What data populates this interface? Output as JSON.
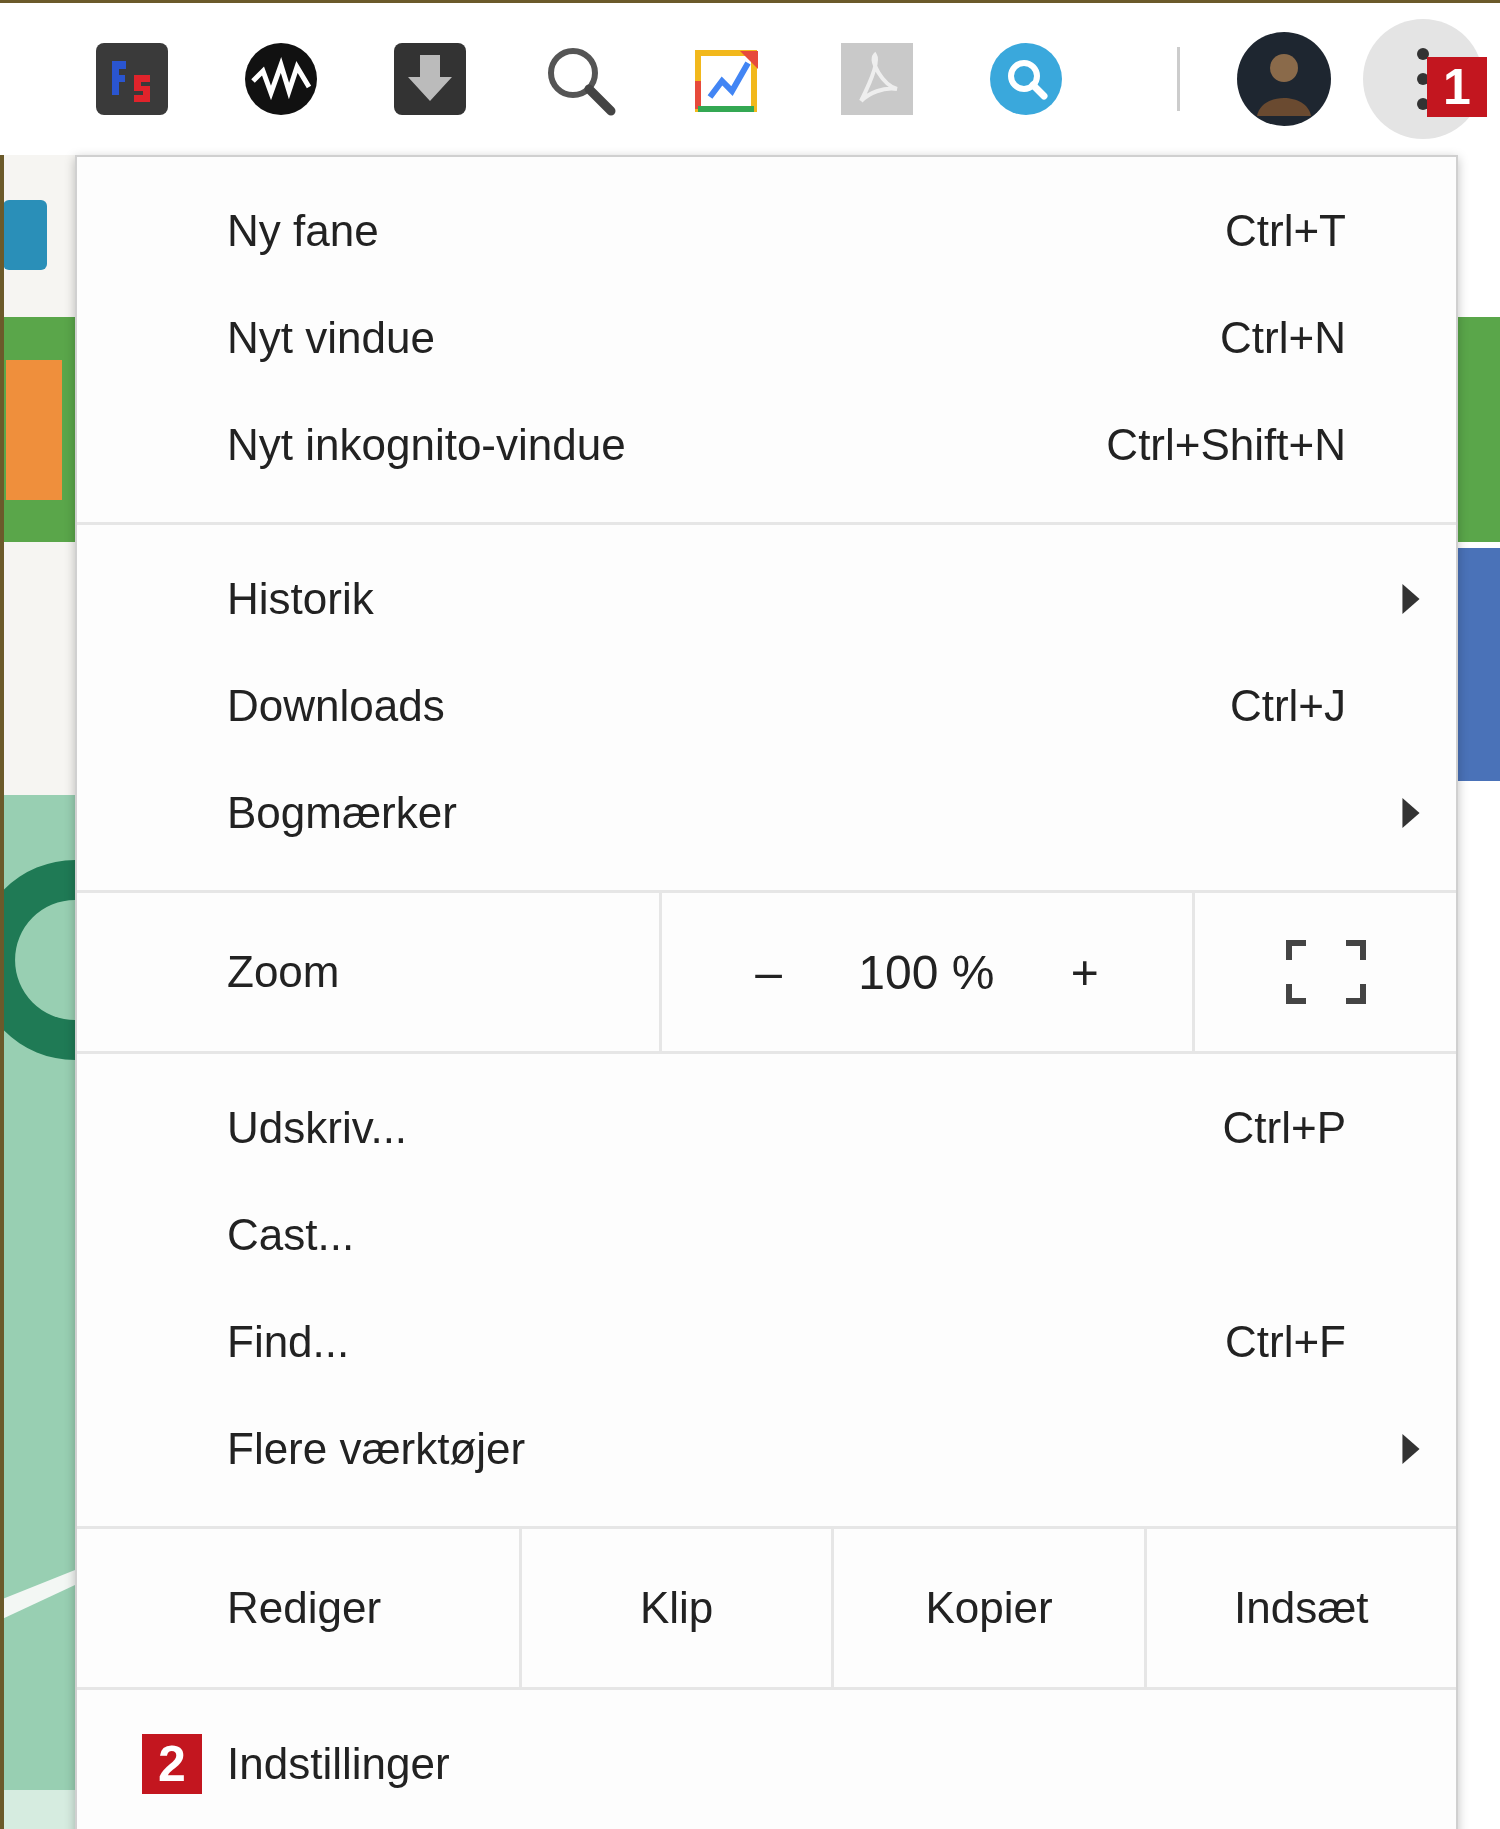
{
  "menu_button": {
    "badge": "1"
  },
  "menu": {
    "sections": [
      {
        "kind": "items",
        "items": [
          {
            "label": "Ny fane",
            "shortcut": "Ctrl+T",
            "submenu": false
          },
          {
            "label": "Nyt vindue",
            "shortcut": "Ctrl+N",
            "submenu": false
          },
          {
            "label": "Nyt inkognito-vindue",
            "shortcut": "Ctrl+Shift+N",
            "submenu": false
          }
        ]
      },
      {
        "kind": "items",
        "items": [
          {
            "label": "Historik",
            "submenu": true
          },
          {
            "label": "Downloads",
            "shortcut": "Ctrl+J",
            "submenu": false
          },
          {
            "label": "Bogmærker",
            "submenu": true
          }
        ]
      },
      {
        "kind": "zoom",
        "label": "Zoom",
        "minus": "–",
        "value": "100 %",
        "plus": "+"
      },
      {
        "kind": "items",
        "items": [
          {
            "label": "Udskriv...",
            "shortcut": "Ctrl+P",
            "submenu": false
          },
          {
            "label": "Cast...",
            "submenu": false
          },
          {
            "label": "Find...",
            "shortcut": "Ctrl+F",
            "submenu": false
          },
          {
            "label": "Flere værktøjer",
            "submenu": true
          }
        ]
      },
      {
        "kind": "edit",
        "label": "Rediger",
        "buttons": [
          "Klip",
          "Kopier",
          "Indsæt"
        ]
      },
      {
        "kind": "items",
        "items": [
          {
            "label": "Indstillinger",
            "badge": "2",
            "submenu": false
          }
        ]
      }
    ]
  }
}
